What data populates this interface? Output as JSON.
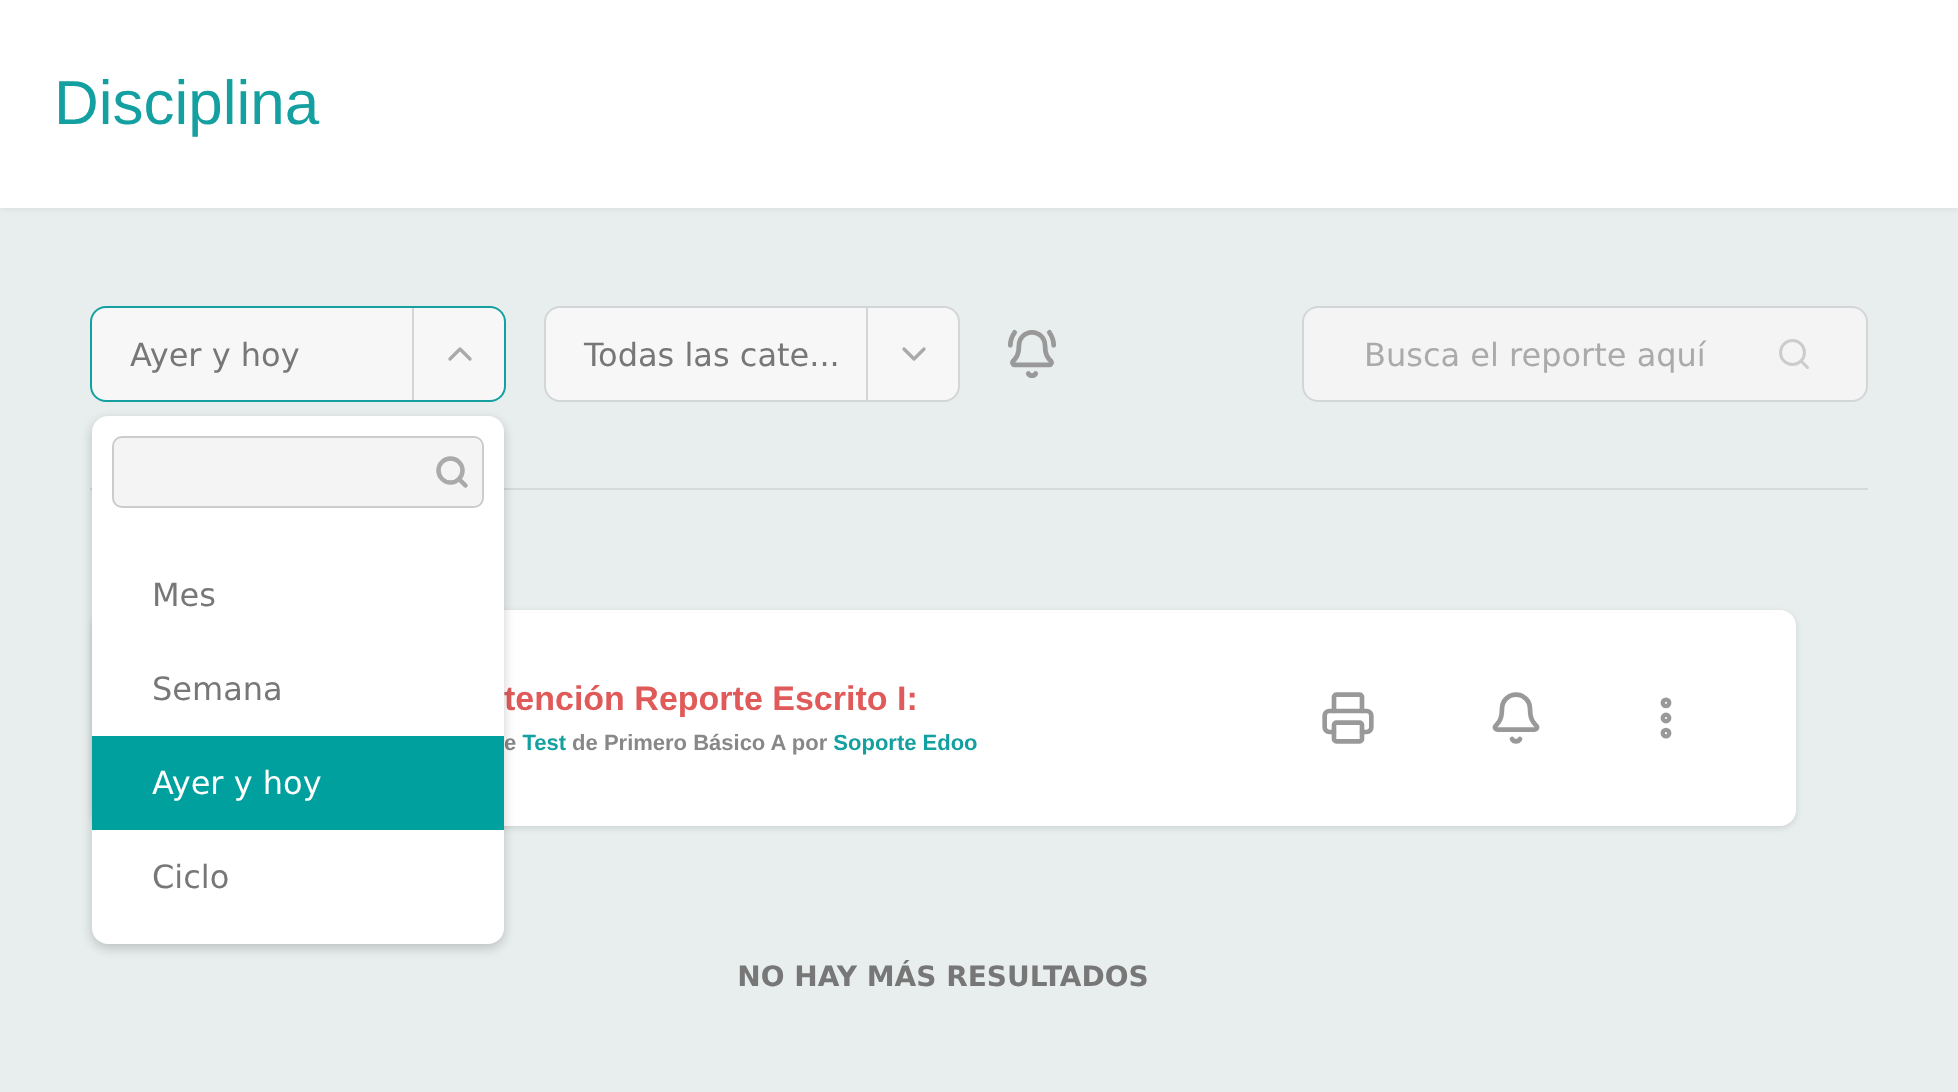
{
  "page_title": "Disciplina",
  "period_select": {
    "value": "Ayer y hoy",
    "expanded": true,
    "options": [
      {
        "label": "Mes",
        "selected": false
      },
      {
        "label": "Semana",
        "selected": false
      },
      {
        "label": "Ayer y hoy",
        "selected": true
      },
      {
        "label": "Ciclo",
        "selected": false
      }
    ]
  },
  "category_select": {
    "value": "Todas las cate...",
    "expanded": false
  },
  "search": {
    "placeholder": "Busca el reporte aquí"
  },
  "reports": [
    {
      "title": "tención Reporte Escrito I:",
      "meta": [
        {
          "text": "e ",
          "kind": "plain"
        },
        {
          "text": "Test",
          "kind": "link"
        },
        {
          "text": " de Primero Básico A por ",
          "kind": "plain"
        },
        {
          "text": "Soporte Edoo",
          "kind": "link"
        }
      ]
    }
  ],
  "end_message": "NO HAY MÁS RESULTADOS"
}
